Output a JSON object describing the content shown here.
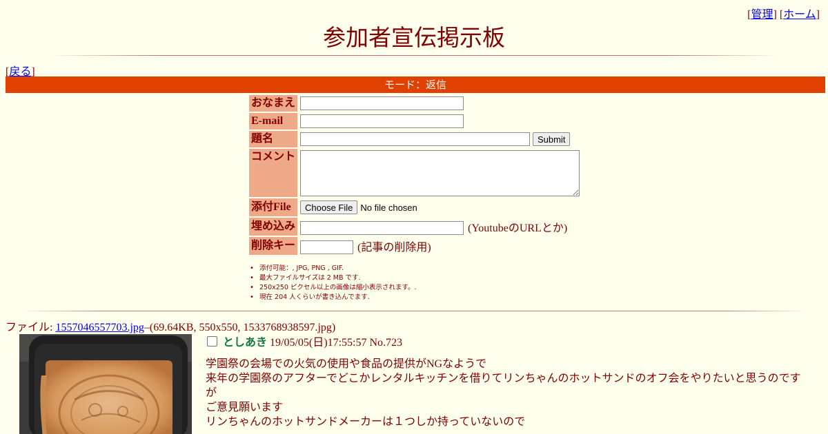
{
  "header": {
    "admin_link": "管理",
    "home_link": "ホーム",
    "title": "参加者宣伝掲示板",
    "back_link": "戻る"
  },
  "mode_bar": "モード：返信",
  "form": {
    "name_label": "おなまえ",
    "email_label": "E-mail",
    "subject_label": "題名",
    "submit_label": "Submit",
    "comment_label": "コメント",
    "file_label": "添付File",
    "choose_file_label": "Choose File",
    "no_file_text": "No file chosen",
    "embed_label": "埋め込み",
    "embed_note": "(YoutubeのURLとか)",
    "delete_key_label": "削除キー",
    "delete_key_note": "(記事の削除用)"
  },
  "rules": [
    "添付可能：, JPG, PNG , GIF.",
    "最大ファイルサイズは 2 MB です.",
    "250x250 ピクセル以上の画像は縮小表示されます。.",
    "現在 204 人くらいが書き込んでます."
  ],
  "post": {
    "file_prefix": "ファイル: ",
    "file_name": "1557046557703.jpg",
    "file_info": "–(69.64KB, 550x550, 1533768938597.jpg)",
    "name": "としあき",
    "datetime": " 19/05/05(日)17:55:57 No.723",
    "lines": [
      "学園祭の会場での火気の使用や食品の提供がNGなようで",
      "来年の学園祭のアフターでどこかレンタルキッチンを借りてリンちゃんのホットサンドのオフ会をやりたいと思うのです",
      "が",
      "ご意見願います",
      "リンちゃんのホットサンドメーカーは１つしか持っていないので"
    ]
  },
  "colors": {
    "background": "#ffffee",
    "text": "#800000",
    "mode_bar": "#e04000",
    "label_bg": "#eeaa88",
    "poster_name": "#117743",
    "link": "#0000ee"
  }
}
